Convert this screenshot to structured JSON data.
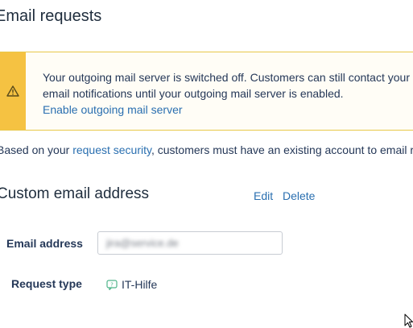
{
  "header": {
    "title": "Email requests"
  },
  "warning": {
    "icon": "warning-triangle-icon",
    "line1": "Your outgoing mail server is switched off. Customers can still contact your",
    "line2": "email notifications until your outgoing mail server is enabled.",
    "link": "Enable outgoing mail server",
    "strip_color": "#f5c242"
  },
  "security": {
    "prefix": "Based on your",
    "link": "request security",
    "suffix": ", customers must have an existing account to email re"
  },
  "custom_email": {
    "title": "Custom email address",
    "edit_label": "Edit",
    "delete_label": "Delete",
    "email_label": "Email address",
    "email_value": "jira@service.de",
    "request_type_label": "Request type",
    "request_type_icon": "help-question-icon",
    "request_type_value": "IT-Hilfe"
  },
  "colors": {
    "link": "#2a6fb0",
    "warning_border": "#e8c84a"
  }
}
